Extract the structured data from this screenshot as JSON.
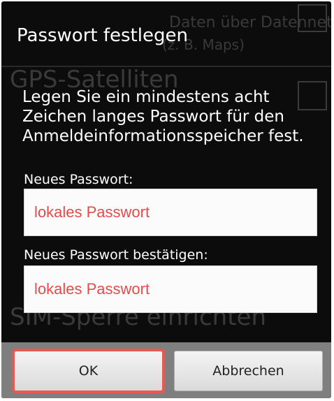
{
  "background_screen": {
    "item1_line1": "Daten über Datennetzwerke",
    "item1_line2": "(z. B. Maps)",
    "item2_title": "GPS-Satelliten",
    "item3_title": "SIM-Sperre einrichten"
  },
  "dialog": {
    "title": "Passwort festlegen",
    "message": "Legen Sie ein mindestens acht Zeichen langes Passwort für den Anmeldeinformationsspeicher fest.",
    "new_password_label": "Neues Passwort:",
    "new_password_value": "lokales Passwort",
    "confirm_password_label": "Neues Passwort bestätigen:",
    "confirm_password_value": "lokales Passwort",
    "ok_label": "OK",
    "cancel_label": "Abbrechen"
  },
  "colors": {
    "dialog_background": "#0c0c0c",
    "field_text": "#e64a4a",
    "highlight_border": "#e85a4f",
    "button_bar": "#7f7f7f"
  }
}
